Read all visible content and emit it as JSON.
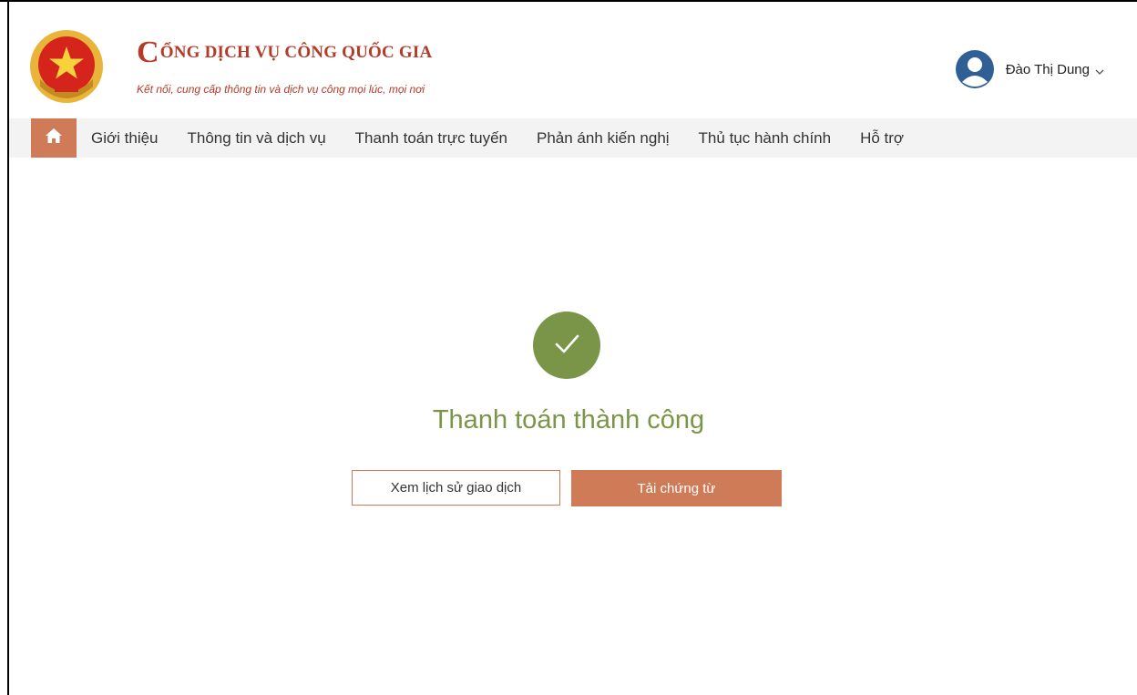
{
  "header": {
    "brand_initial": "C",
    "brand_title_rest": "ỔNG DỊCH VỤ CÔNG QUỐC GIA",
    "brand_subtitle": "Kết nối, cung cấp thông tin và dịch vụ công mọi lúc, mọi nơi",
    "emblem_icon": "national-emblem-icon",
    "user": {
      "name": "Đào Thị Dung",
      "avatar_icon": "user-avatar-icon",
      "dropdown_icon": "chevron-down-icon"
    }
  },
  "nav": {
    "home_icon": "home-icon",
    "items": [
      {
        "label": "Giới thiệu"
      },
      {
        "label": "Thông tin và dịch vụ"
      },
      {
        "label": "Thanh toán trực tuyến"
      },
      {
        "label": "Phản ánh kiến nghị"
      },
      {
        "label": "Thủ tục hành chính"
      },
      {
        "label": "Hỗ trợ"
      }
    ]
  },
  "main": {
    "status_icon": "check-icon",
    "title": "Thanh toán thành công",
    "history_button": "Xem lịch sử giao dịch",
    "download_button": "Tải chứng từ"
  },
  "colors": {
    "brand": "#b43b27",
    "accent": "#d07b58",
    "success": "#7b9548",
    "nav_bg": "#f3f3f3"
  }
}
